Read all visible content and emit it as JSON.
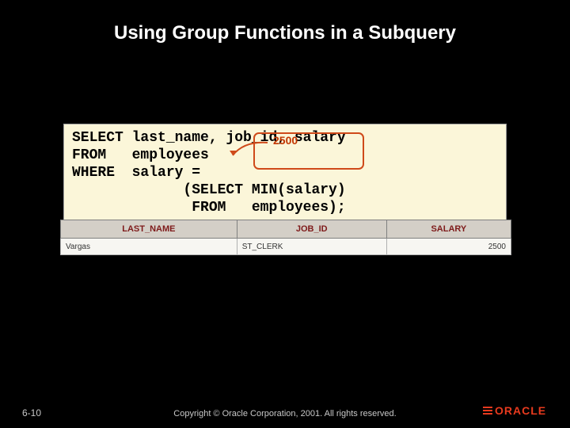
{
  "title": "Using Group Functions in a Subquery",
  "code": {
    "line1": "SELECT last_name, job_id, salary",
    "line2": "FROM   employees",
    "line3": "WHERE  salary =",
    "line4": "             (SELECT MIN(salary)",
    "line5": "              FROM   employees);"
  },
  "callout_value": "2500",
  "result": {
    "headers": [
      "LAST_NAME",
      "JOB_ID",
      "SALARY"
    ],
    "row": {
      "last_name": "Vargas",
      "job_id": "ST_CLERK",
      "salary": "2500"
    }
  },
  "footer": {
    "page": "6-10",
    "copyright": "Copyright © Oracle Corporation, 2001. All rights reserved.",
    "logo_text": "ORACLE"
  }
}
